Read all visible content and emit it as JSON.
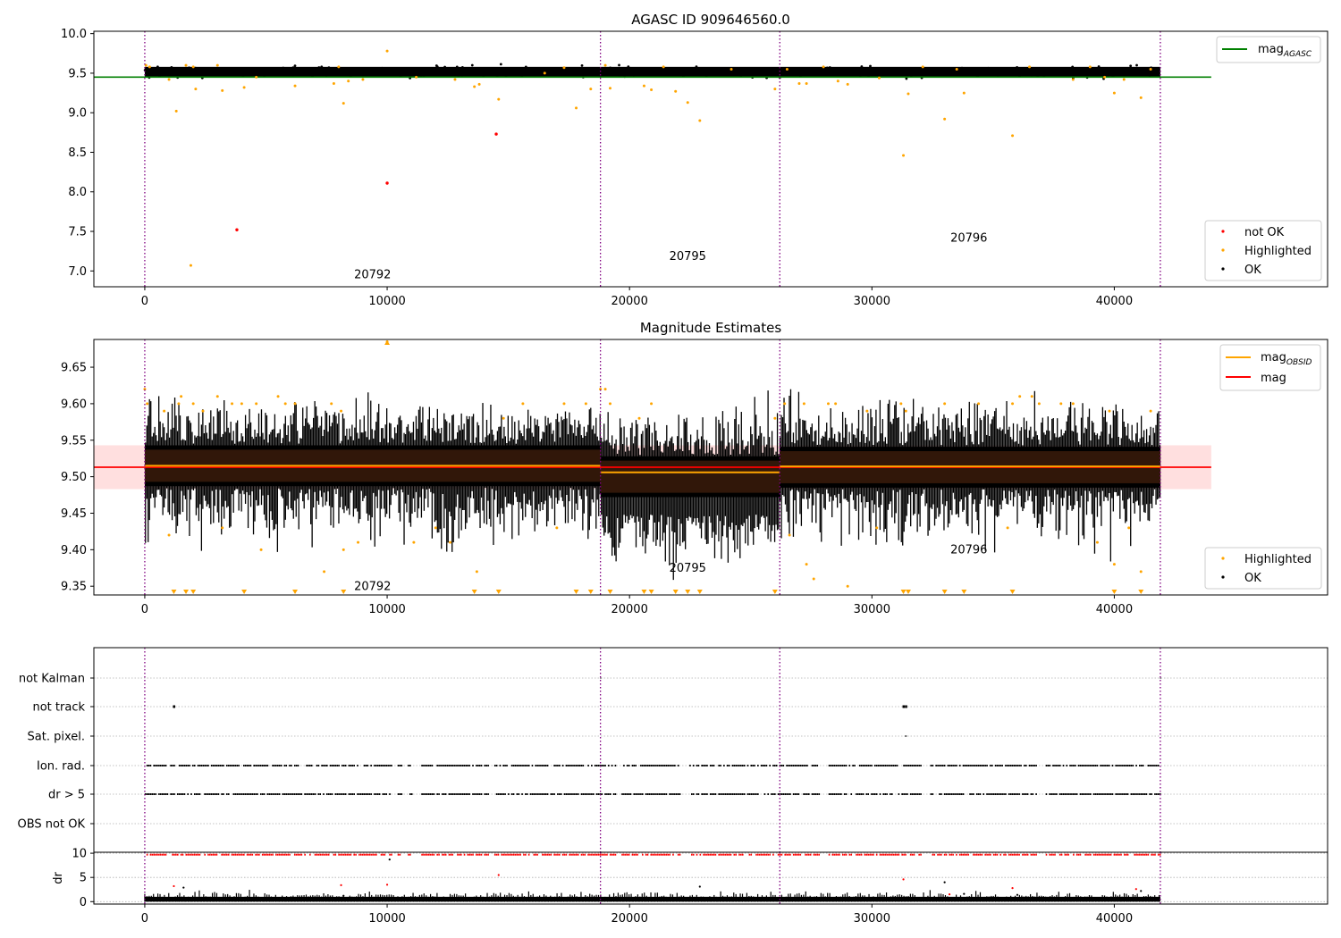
{
  "chart_data": [
    {
      "type": "scatter",
      "title": "AGASC ID 909646560.0",
      "xlim": [
        -2100,
        48800
      ],
      "ylim": [
        6.8,
        10.03
      ],
      "xticks": [
        0,
        10000,
        20000,
        30000,
        40000
      ],
      "xtick_labels": [
        "0",
        "10000",
        "20000",
        "30000",
        "40000"
      ],
      "yticks": [
        7.0,
        7.5,
        8.0,
        8.5,
        9.0,
        9.5,
        10.0
      ],
      "ytick_labels": [
        "7.0",
        "7.5",
        "8.0",
        "8.5",
        "9.0",
        "9.5",
        "10.0"
      ],
      "mag_agasc": 9.45,
      "obsid_boundaries": [
        0,
        18800,
        26200,
        41900
      ],
      "obsid_labels": [
        {
          "text": "20792",
          "x": 9400,
          "y": 6.91
        },
        {
          "text": "20795",
          "x": 22400,
          "y": 7.14
        },
        {
          "text": "20796",
          "x": 34000,
          "y": 7.37
        }
      ],
      "ok_band": {
        "center": 9.52,
        "half_width": 0.045
      },
      "highlighted": [
        [
          50,
          9.6
        ],
        [
          200,
          9.58
        ],
        [
          1000,
          9.42
        ],
        [
          1300,
          9.02
        ],
        [
          1700,
          9.6
        ],
        [
          1900,
          7.07
        ],
        [
          2000,
          9.58
        ],
        [
          2100,
          9.3
        ],
        [
          3000,
          9.6
        ],
        [
          3200,
          9.28
        ],
        [
          4100,
          9.32
        ],
        [
          4600,
          9.45
        ],
        [
          6200,
          9.34
        ],
        [
          7800,
          9.37
        ],
        [
          8000,
          9.58
        ],
        [
          8200,
          9.12
        ],
        [
          8400,
          9.4
        ],
        [
          9000,
          9.42
        ],
        [
          10000,
          9.78
        ],
        [
          11200,
          9.45
        ],
        [
          12800,
          9.42
        ],
        [
          13600,
          9.33
        ],
        [
          13800,
          9.36
        ],
        [
          14600,
          9.17
        ],
        [
          16500,
          9.5
        ],
        [
          17300,
          9.57
        ],
        [
          17800,
          9.06
        ],
        [
          18400,
          9.3
        ],
        [
          19000,
          9.6
        ],
        [
          19200,
          9.31
        ],
        [
          20600,
          9.34
        ],
        [
          20900,
          9.29
        ],
        [
          21400,
          9.58
        ],
        [
          21900,
          9.27
        ],
        [
          22400,
          9.13
        ],
        [
          22900,
          8.9
        ],
        [
          24200,
          9.55
        ],
        [
          26000,
          9.3
        ],
        [
          26500,
          9.55
        ],
        [
          27000,
          9.37
        ],
        [
          27300,
          9.37
        ],
        [
          28000,
          9.58
        ],
        [
          28600,
          9.4
        ],
        [
          29000,
          9.36
        ],
        [
          30300,
          9.44
        ],
        [
          31300,
          8.46
        ],
        [
          31500,
          9.24
        ],
        [
          32100,
          9.58
        ],
        [
          33000,
          8.92
        ],
        [
          33500,
          9.55
        ],
        [
          33800,
          9.25
        ],
        [
          35800,
          8.71
        ],
        [
          36500,
          9.58
        ],
        [
          38300,
          9.42
        ],
        [
          39000,
          9.58
        ],
        [
          39600,
          9.45
        ],
        [
          40000,
          9.25
        ],
        [
          40400,
          9.42
        ],
        [
          41100,
          9.19
        ],
        [
          41500,
          9.55
        ]
      ],
      "not_ok": [
        [
          3800,
          7.52
        ],
        [
          10000,
          8.11
        ],
        [
          14500,
          8.73
        ]
      ],
      "legend_top": {
        "entries": [
          "mag$_{AGASC}$"
        ]
      },
      "legend_bottom": {
        "entries": [
          "not OK",
          "Highlighted",
          "OK"
        ]
      }
    },
    {
      "type": "scatter",
      "title": "Magnitude Estimates",
      "xlim": [
        -2100,
        48800
      ],
      "ylim": [
        9.338,
        9.688
      ],
      "xticks": [
        0,
        10000,
        20000,
        30000,
        40000
      ],
      "xtick_labels": [
        "0",
        "10000",
        "20000",
        "30000",
        "40000"
      ],
      "yticks": [
        9.35,
        9.4,
        9.45,
        9.5,
        9.55,
        9.6,
        9.65
      ],
      "ytick_labels": [
        "9.35",
        "9.40",
        "9.45",
        "9.50",
        "9.55",
        "9.60",
        "9.65"
      ],
      "mag": 9.513,
      "mag_band": [
        9.483,
        9.543
      ],
      "mag_obsid": [
        {
          "x0": 0,
          "x1": 18800,
          "y": 9.515
        },
        {
          "x0": 18800,
          "x1": 26200,
          "y": 9.506
        },
        {
          "x0": 26200,
          "x1": 41900,
          "y": 9.514
        }
      ],
      "obsid_boundaries": [
        0,
        18800,
        26200,
        41900
      ],
      "obsid_labels": [
        {
          "text": "20792",
          "x": 9400,
          "y": 9.345
        },
        {
          "text": "20795",
          "x": 22400,
          "y": 9.37
        },
        {
          "text": "20796",
          "x": 34000,
          "y": 9.395
        }
      ],
      "highlighted": [
        [
          0,
          9.62
        ],
        [
          100,
          9.6
        ],
        [
          800,
          9.59
        ],
        [
          1000,
          9.42
        ],
        [
          1400,
          9.6
        ],
        [
          1500,
          9.61
        ],
        [
          2000,
          9.6
        ],
        [
          2400,
          9.59
        ],
        [
          3000,
          9.61
        ],
        [
          3200,
          9.43
        ],
        [
          3600,
          9.6
        ],
        [
          4000,
          9.6
        ],
        [
          4600,
          9.6
        ],
        [
          4800,
          9.4
        ],
        [
          5500,
          9.61
        ],
        [
          5800,
          9.6
        ],
        [
          6200,
          9.6
        ],
        [
          7400,
          9.37
        ],
        [
          7700,
          9.6
        ],
        [
          8100,
          9.59
        ],
        [
          8200,
          9.4
        ],
        [
          8800,
          9.41
        ],
        [
          10000,
          9.685
        ],
        [
          11100,
          9.41
        ],
        [
          12000,
          9.43
        ],
        [
          12600,
          9.41
        ],
        [
          13700,
          9.37
        ],
        [
          14800,
          9.58
        ],
        [
          15600,
          9.6
        ],
        [
          17000,
          9.43
        ],
        [
          17300,
          9.6
        ],
        [
          18200,
          9.6
        ],
        [
          18800,
          9.62
        ],
        [
          19000,
          9.62
        ],
        [
          19200,
          9.6
        ],
        [
          20400,
          9.58
        ],
        [
          20900,
          9.6
        ],
        [
          26000,
          9.58
        ],
        [
          26400,
          9.6
        ],
        [
          26600,
          9.42
        ],
        [
          27200,
          9.6
        ],
        [
          27300,
          9.38
        ],
        [
          27600,
          9.36
        ],
        [
          28200,
          9.6
        ],
        [
          28500,
          9.6
        ],
        [
          29000,
          9.35
        ],
        [
          29800,
          9.59
        ],
        [
          30200,
          9.43
        ],
        [
          31200,
          9.6
        ],
        [
          31400,
          9.59
        ],
        [
          33000,
          9.6
        ],
        [
          34400,
          9.6
        ],
        [
          35600,
          9.43
        ],
        [
          35800,
          9.6
        ],
        [
          36100,
          9.61
        ],
        [
          36600,
          9.61
        ],
        [
          36900,
          9.6
        ],
        [
          37800,
          9.6
        ],
        [
          38300,
          9.6
        ],
        [
          39300,
          9.41
        ],
        [
          39800,
          9.59
        ],
        [
          40000,
          9.38
        ],
        [
          40600,
          9.43
        ],
        [
          41100,
          9.37
        ],
        [
          41500,
          9.59
        ]
      ],
      "below_axis_markers": [
        1200,
        1700,
        2000,
        4100,
        6200,
        8200,
        13600,
        14600,
        17800,
        18400,
        19200,
        20600,
        20900,
        21900,
        22400,
        22900,
        26000,
        31300,
        31500,
        33000,
        33800,
        35800,
        40000,
        41100
      ],
      "above_axis_markers": [
        10000
      ],
      "legend_top": {
        "entries": [
          "mag$_{OBSID}$",
          "mag"
        ]
      },
      "legend_bottom": {
        "entries": [
          "Highlighted",
          "OK"
        ]
      }
    },
    {
      "type": "scatter",
      "xlim": [
        -2100,
        48800
      ],
      "category_labels": [
        "not Kalman",
        "not track",
        "Sat. pixel.",
        "Ion. rad.",
        "dr > 5",
        "OBS not OK"
      ],
      "flag_rows": {
        "not_track": [
          1200,
          31300,
          31400
        ],
        "sat_pixel": [
          31400
        ],
        "not_kalman": [
          18800,
          41900
        ]
      },
      "gaps": [
        [
          10200,
          10400
        ],
        [
          10600,
          10800
        ],
        [
          11000,
          11400
        ],
        [
          14200,
          14400
        ],
        [
          19400,
          19600
        ],
        [
          22100,
          22400
        ],
        [
          27800,
          28200
        ],
        [
          32000,
          32400
        ],
        [
          36800,
          37100
        ]
      ],
      "obsid_boundaries": [
        0,
        18800,
        26200,
        41900
      ]
    },
    {
      "type": "scatter",
      "ylabel": "dr",
      "xlim": [
        -2100,
        48800
      ],
      "ylim": [
        -0.5,
        10.2
      ],
      "yticks": [
        0,
        5,
        10
      ],
      "ytick_labels": [
        "0",
        "5",
        "10"
      ],
      "xticks": [
        0,
        10000,
        20000,
        30000,
        40000
      ],
      "xtick_labels": [
        "0",
        "10000",
        "20000",
        "30000",
        "40000"
      ],
      "clipped_value": 9.7,
      "dr_outliers": [
        [
          1200,
          3.2
        ],
        [
          1600,
          2.9
        ],
        [
          8100,
          3.4
        ],
        [
          8200,
          1.2
        ],
        [
          10000,
          3.5
        ],
        [
          10100,
          8.7
        ],
        [
          14600,
          5.5
        ],
        [
          22900,
          3.1
        ],
        [
          31300,
          4.6
        ],
        [
          33000,
          4.0
        ],
        [
          33200,
          1.5
        ],
        [
          33800,
          1.6
        ],
        [
          35800,
          2.8
        ],
        [
          36000,
          1.4
        ],
        [
          40900,
          2.6
        ],
        [
          41100,
          2.2
        ]
      ],
      "obsid_boundaries": [
        0,
        18800,
        26200,
        41900
      ]
    }
  ]
}
